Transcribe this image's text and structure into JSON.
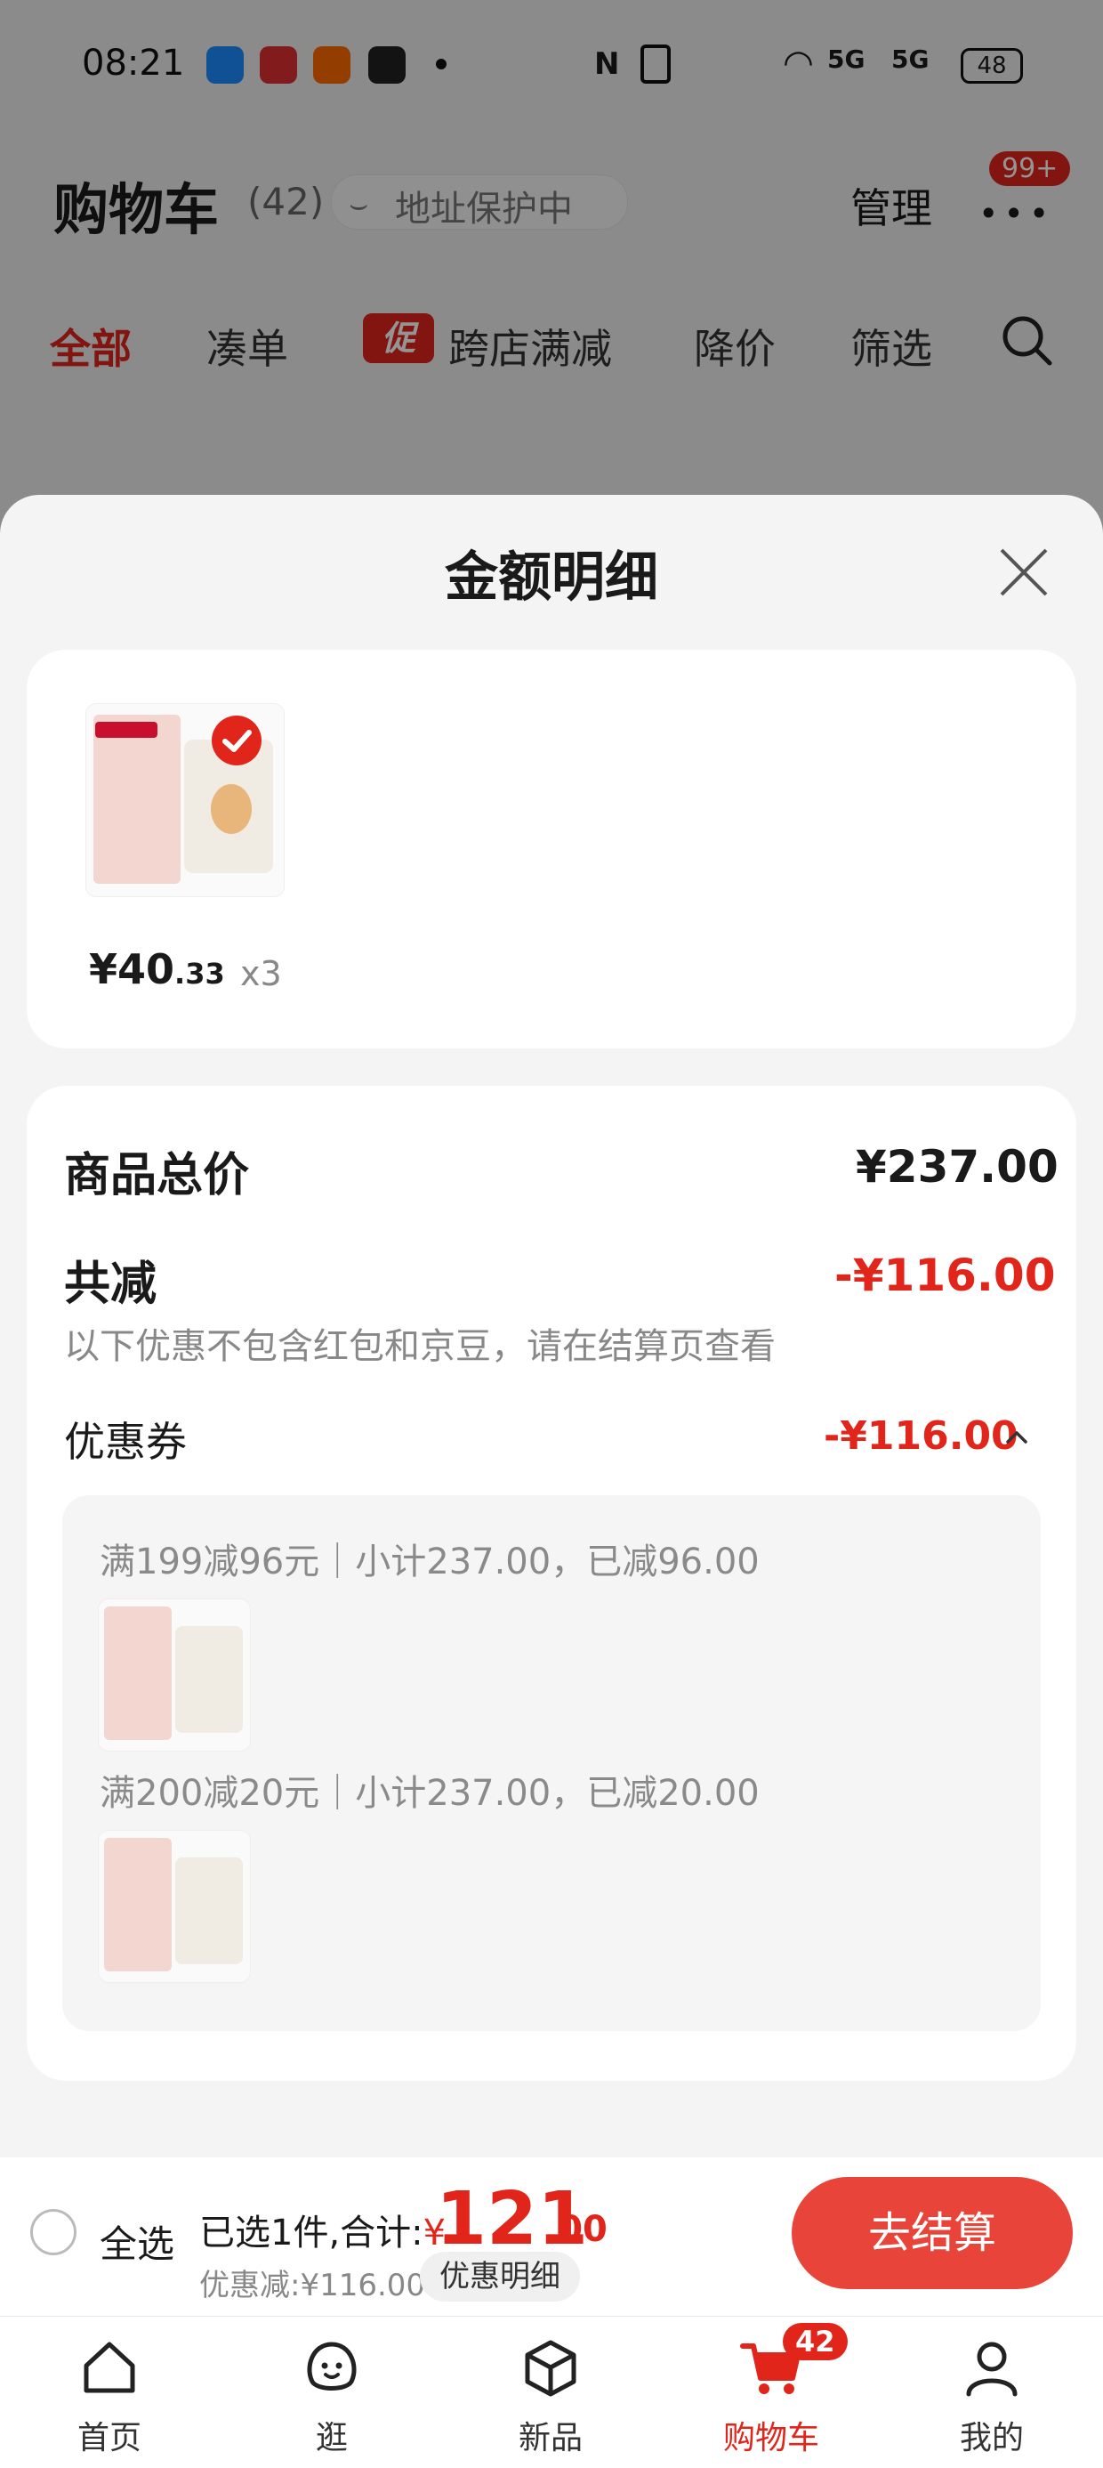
{
  "status_bar": {
    "time": "08:21",
    "signal_text": "5G",
    "battery": "48"
  },
  "header": {
    "title": "购物车",
    "count": "(42)",
    "address_protect": "地址保护中",
    "manage": "管理",
    "badge": "99+"
  },
  "tabs": [
    "全部",
    "凑单",
    "跨店满减",
    "降价",
    "筛选"
  ],
  "promo_tag": "促",
  "sheet": {
    "title": "金额明细",
    "product": {
      "price_main": "¥40",
      "price_decimal": ".33",
      "quantity": "x3"
    },
    "total_label": "商品总价",
    "total_value": "¥237.00",
    "discount_label": "共减",
    "discount_value": "-¥116.00",
    "note": "以下优惠不包含红包和京豆，请在结算页查看",
    "coupon_label": "优惠券",
    "coupon_value": "-¥116.00",
    "rules": [
      "满199减96元｜小计237.00，已减96.00",
      "满200减20元｜小计237.00，已减20.00"
    ]
  },
  "checkout": {
    "select_all": "全选",
    "selected_text": "已选1件,合计:",
    "currency": "¥",
    "total_int": "121",
    "total_dec": ".00",
    "saving": "优惠减:¥116.00",
    "detail_chip": "优惠明细",
    "button": "去结算"
  },
  "nav": {
    "items": [
      {
        "label": "首页",
        "icon": "home-icon"
      },
      {
        "label": "逛",
        "icon": "smiley-icon"
      },
      {
        "label": "新品",
        "icon": "box-icon"
      },
      {
        "label": "购物车",
        "icon": "cart-icon"
      },
      {
        "label": "我的",
        "icon": "person-icon"
      }
    ],
    "cart_badge": "42",
    "active_index": 3
  },
  "colors": {
    "accent": "#e1251b",
    "button": "#e8443a"
  }
}
